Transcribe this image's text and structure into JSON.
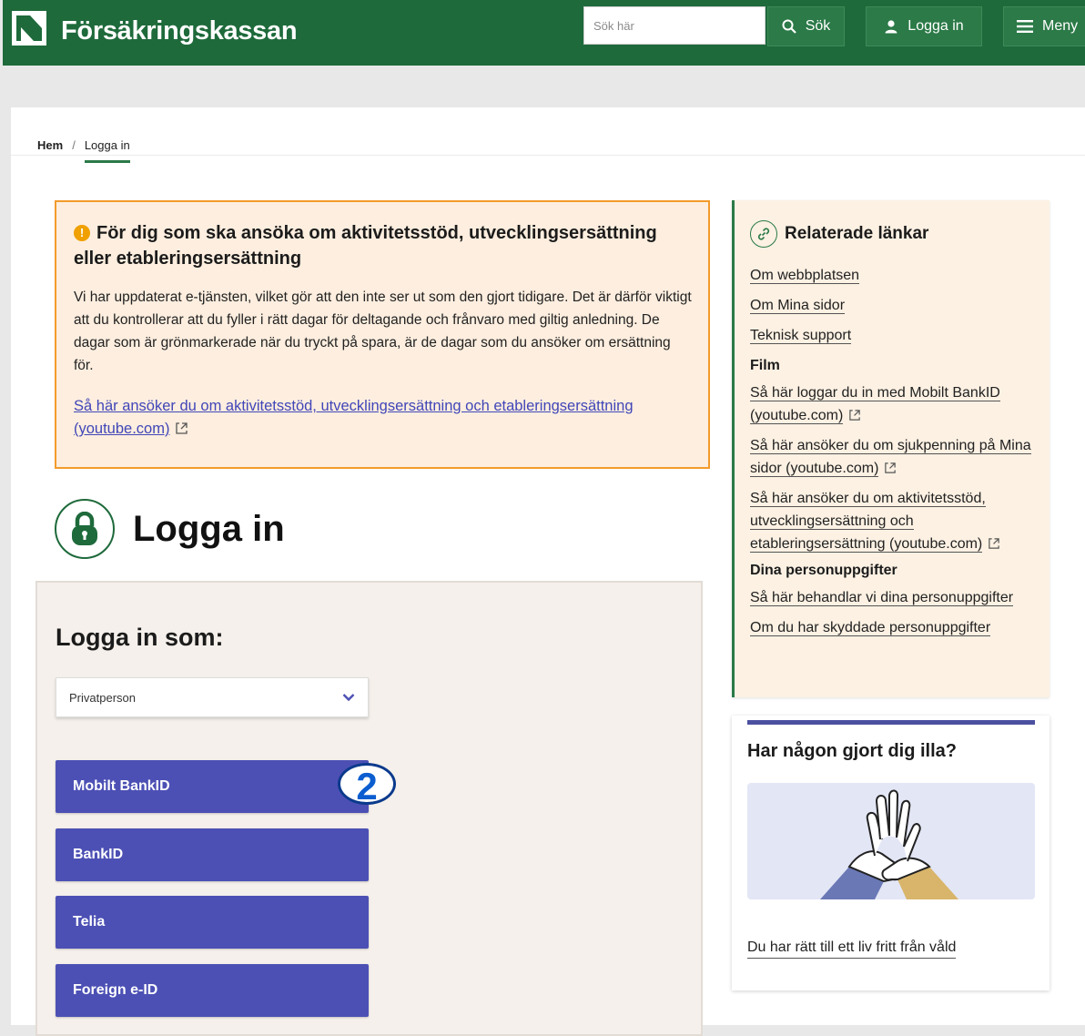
{
  "header": {
    "brand": "Försäkringskassan",
    "search_placeholder": "Sök här",
    "search_label": "Sök",
    "login_label": "Logga in",
    "menu_label": "Meny"
  },
  "breadcrumb": {
    "home": "Hem",
    "separator": "/",
    "current": "Logga in"
  },
  "notice": {
    "icon": "exclamation-icon",
    "title": "För dig som ska ansöka om aktivitetsstöd, utvecklingsersättning eller etableringsersättning",
    "body": "Vi har uppdaterat e-tjänsten, vilket gör att den inte ser ut som den gjort tidigare. Det är därför viktigt att du kontrollerar att du fyller i rätt dagar för deltagande och frånvaro med giltig anledning. De dagar som är grönmarkerade när du tryckt på spara, är de dagar som du ansöker om ersättning för.",
    "link": "Så här ansöker du om aktivitetsstöd, utvecklingsersättning och etableringsersättning (youtube.com)"
  },
  "login": {
    "title": "Logga in",
    "as_title": "Logga in som:",
    "selected_role": "Privatperson",
    "step_badge": "2",
    "methods": [
      "Mobilt BankID",
      "BankID",
      "Telia",
      "Foreign e-ID"
    ]
  },
  "related": {
    "title": "Relaterade länkar",
    "links": [
      "Om webbplatsen",
      "Om Mina sidor",
      "Teknisk support"
    ],
    "film_heading": "Film",
    "film_links": [
      "Så här loggar du in med Mobilt BankID (youtube.com)",
      "Så här ansöker du om sjukpenning på Mina sidor (youtube.com)",
      "Så här ansöker du om aktivitetsstöd, utvecklingsersättning och etableringsersättning (youtube.com)"
    ],
    "personal_heading": "Dina personuppgifter",
    "personal_links": [
      "Så här behandlar vi dina personuppgifter",
      "Om du har skyddade personuppgifter"
    ]
  },
  "abuse": {
    "title": "Har någon gjort dig illa?",
    "link": "Du har rätt till ett liv fritt från våld"
  },
  "colors": {
    "header_green": "#1e6a3b",
    "button_blue": "#4c50b4",
    "notice_border": "#f39b2b",
    "notice_bg": "#fdeedf",
    "link_blue": "#4046b8"
  }
}
